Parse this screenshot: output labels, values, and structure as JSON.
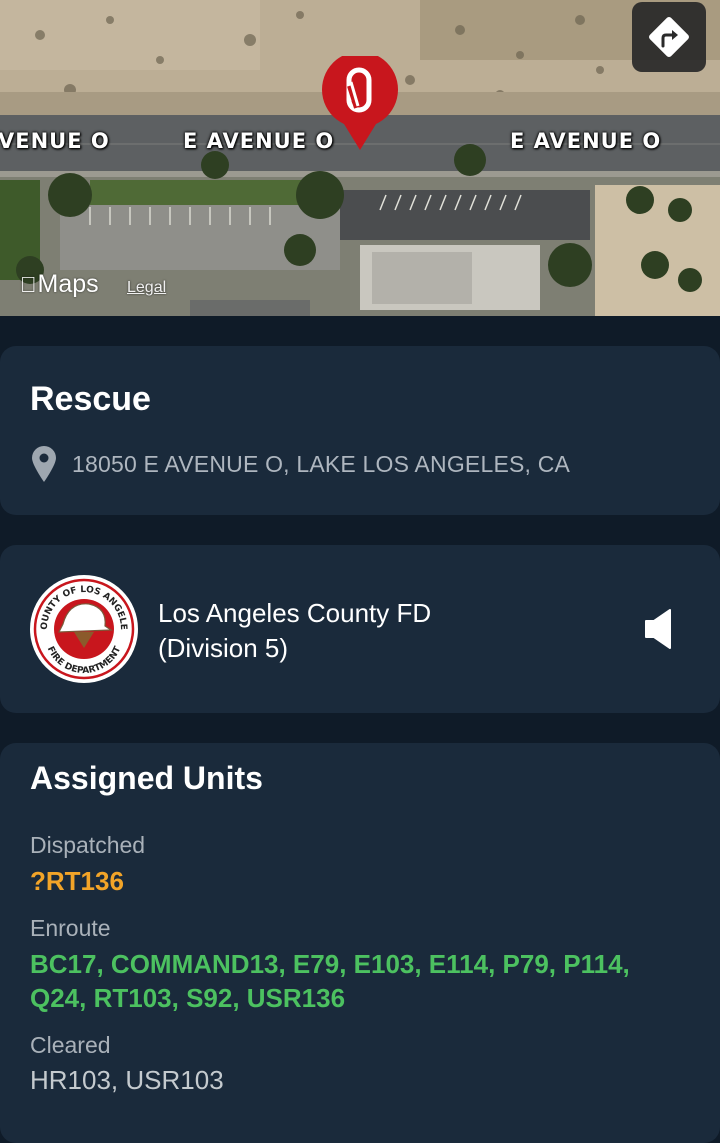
{
  "map": {
    "road_labels": [
      "VENUE O",
      "E AVENUE O",
      "E AVENUE O"
    ],
    "attribution_logo": "Maps",
    "legal_link": "Legal",
    "directions_icon": "turn-right-directions-icon",
    "pin_icon": "carabiner-pin-icon",
    "pin_color": "#c8161d"
  },
  "incident": {
    "type": "Rescue",
    "address": "18050 E AVENUE O, LAKE LOS ANGELES, CA",
    "address_icon": "location-pin-icon"
  },
  "agency": {
    "name_line1": "Los Angeles County FD",
    "name_line2": "(Division 5)",
    "logo": {
      "top_text": "COUNTY OF LOS ANGELES",
      "bottom_text": "FIRE DEPARTMENT"
    },
    "audio_icon": "speaker-icon"
  },
  "units": {
    "title": "Assigned Units",
    "groups": [
      {
        "label": "Dispatched",
        "units": "?RT136",
        "color": "#f2a428"
      },
      {
        "label": "Enroute",
        "units": "BC17, COMMAND13, E79, E103, E114, P79, P114, Q24, RT103, S92, USR136",
        "color": "#4cc160"
      },
      {
        "label": "Cleared",
        "units": "HR103, USR103",
        "color": "#c4cace"
      }
    ]
  }
}
